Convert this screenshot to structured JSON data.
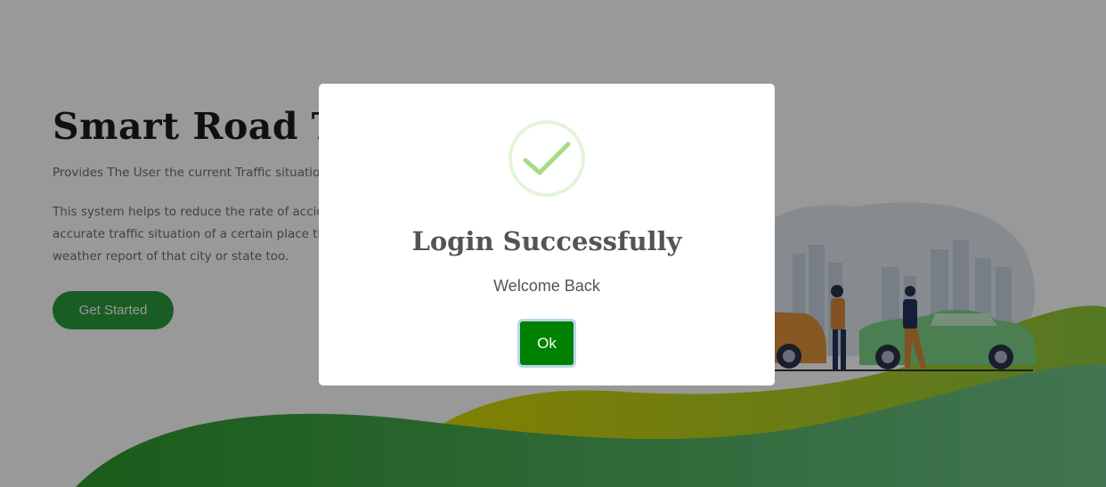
{
  "hero": {
    "title": "Smart Road Traffic",
    "subtitle": "Provides The User the current Traffic situation",
    "description_lines": [
      "This system helps to reduce the rate of accidents",
      "accurate traffic situation of a certain place the",
      "weather report of that city or state too."
    ],
    "cta_label": "Get Started"
  },
  "modal": {
    "title": "Login Successfully",
    "text": "Welcome Back",
    "ok_label": "Ok"
  },
  "colors": {
    "success_check": "#a5dc86",
    "ok_button": "#008000",
    "cta_button": "#2a9a3c",
    "wave_green": "#2e8b3a",
    "wave_olive": "#9aa010"
  }
}
